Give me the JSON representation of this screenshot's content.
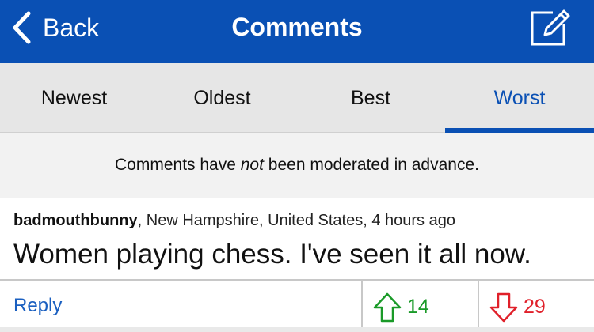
{
  "header": {
    "back_label": "Back",
    "title": "Comments",
    "back_icon": "chevron-left-icon",
    "compose_icon": "compose-icon"
  },
  "tabs": [
    {
      "label": "Newest",
      "active": false
    },
    {
      "label": "Oldest",
      "active": false
    },
    {
      "label": "Best",
      "active": false
    },
    {
      "label": "Worst",
      "active": true
    }
  ],
  "notice": {
    "prefix": "Comments have ",
    "emphasis": "not",
    "suffix": " been moderated in advance."
  },
  "comment": {
    "username": "badmouthbunny",
    "location_time": ", New Hampshire, United States, 4 hours ago",
    "text": "Women playing chess. I've seen it all now.",
    "reply_label": "Reply",
    "upvotes": "14",
    "downvotes": "29",
    "upvote_icon": "arrow-up-icon",
    "downvote_icon": "arrow-down-icon"
  },
  "colors": {
    "brand_blue": "#0a50b4",
    "upvote_green": "#1a9a28",
    "downvote_red": "#e0202a"
  }
}
